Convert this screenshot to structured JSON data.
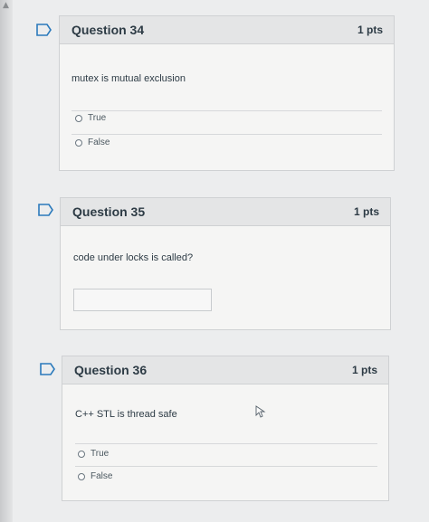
{
  "page": {
    "scroll_caret_icon": "chevron-up-icon"
  },
  "questions": [
    {
      "title": "Question 34",
      "points": "1 pts",
      "text": "mutex is mutual exclusion",
      "options": [
        "True",
        "False"
      ],
      "flag_icon": "flag-outline-icon"
    },
    {
      "title": "Question 35",
      "points": "1 pts",
      "text": "code under locks is called?",
      "input_value": "",
      "flag_icon": "flag-outline-icon"
    },
    {
      "title": "Question 36",
      "points": "1 pts",
      "text": "C++ STL is thread safe",
      "options": [
        "True",
        "False"
      ],
      "flag_icon": "flag-outline-icon"
    }
  ],
  "colors": {
    "background": "#ecedee",
    "card_background": "#f5f5f4",
    "header_background": "#e4e5e6",
    "text": "#2d3b45",
    "flag_blue": "#2b7abc"
  }
}
